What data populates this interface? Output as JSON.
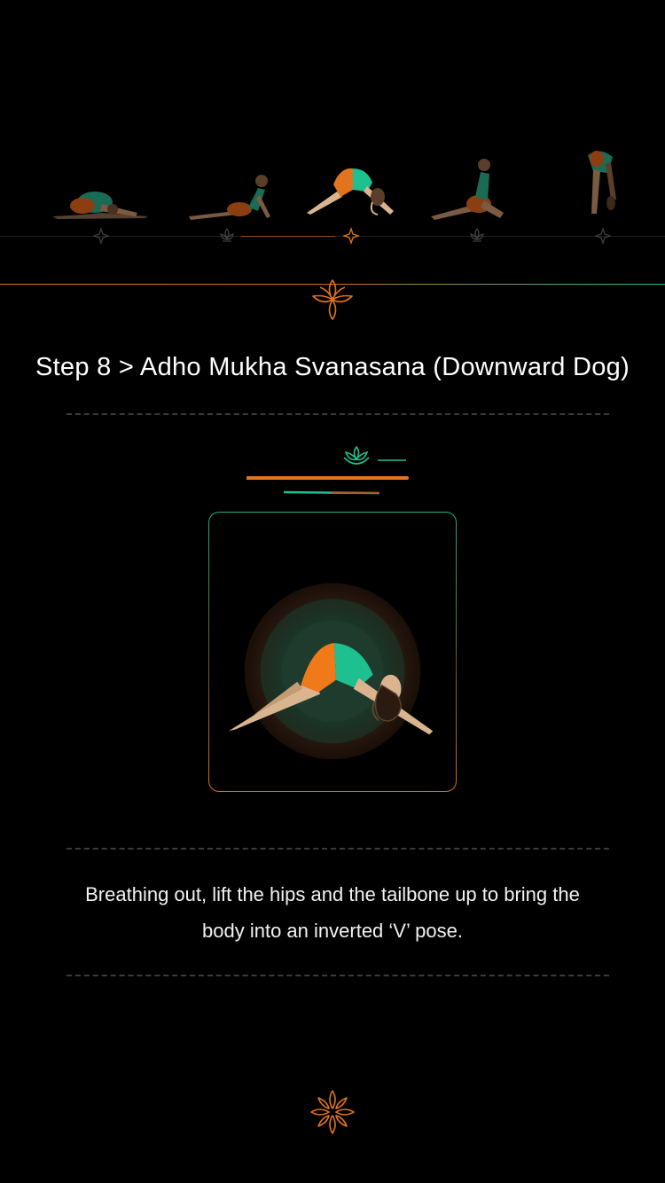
{
  "carousel": {
    "poses": [
      {
        "name": "balasana-child-pose",
        "state": "previous"
      },
      {
        "name": "bhujangasana-cobra-pose",
        "state": "previous"
      },
      {
        "name": "adho-mukha-svanasana-downward-dog",
        "state": "current"
      },
      {
        "name": "ashwa-sanchalanasana-equestrian-pose",
        "state": "next"
      },
      {
        "name": "hasta-padasana-forward-bend",
        "state": "next"
      }
    ],
    "marker_icon": "lotus-flower-icon"
  },
  "step": {
    "title": "Step 8 > Adho Mukha Svanasana (Downward Dog)",
    "description": "Breathing out, lift the hips and the tailbone up to bring the body into an inverted ‘V’ pose."
  },
  "colors": {
    "background": "#000000",
    "accent_orange": "#E3741D",
    "accent_green": "#1FC08F",
    "skin": "#D9B48F",
    "text": "#FFFFFF"
  },
  "icons": {
    "header_lotus": "lotus-outline-icon",
    "breath_lotus": "lotus-green-icon",
    "footer_lotus": "lotus-flower-icon"
  }
}
